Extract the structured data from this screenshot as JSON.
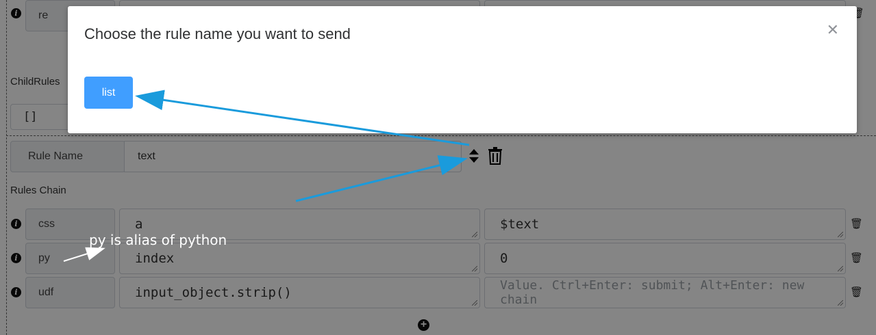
{
  "background": {
    "top_row": {
      "label": "re"
    },
    "child_rules_label": "ChildRules",
    "child_rules_value": "[]",
    "rule_name_label": "Rule Name",
    "rule_name_value": "text",
    "rules_chain_label": "Rules Chain",
    "chain_rows": [
      {
        "type": "css",
        "arg": "a",
        "value": "$text",
        "value_placeholder": ""
      },
      {
        "type": "py",
        "arg": "index",
        "value": "0",
        "value_placeholder": ""
      },
      {
        "type": "udf",
        "arg": "input_object.strip()",
        "value": "",
        "value_placeholder": "Value. Ctrl+Enter: submit; Alt+Enter: new chain"
      }
    ]
  },
  "modal": {
    "title": "Choose the rule name you want to send",
    "close_icon": "close-icon",
    "button_label": "list"
  },
  "annotation": {
    "text": "py is alias of python",
    "arrow_color": "#1a9bdc"
  },
  "colors": {
    "primary": "#409eff",
    "overlay": "rgba(0,0,0,0.48)"
  }
}
